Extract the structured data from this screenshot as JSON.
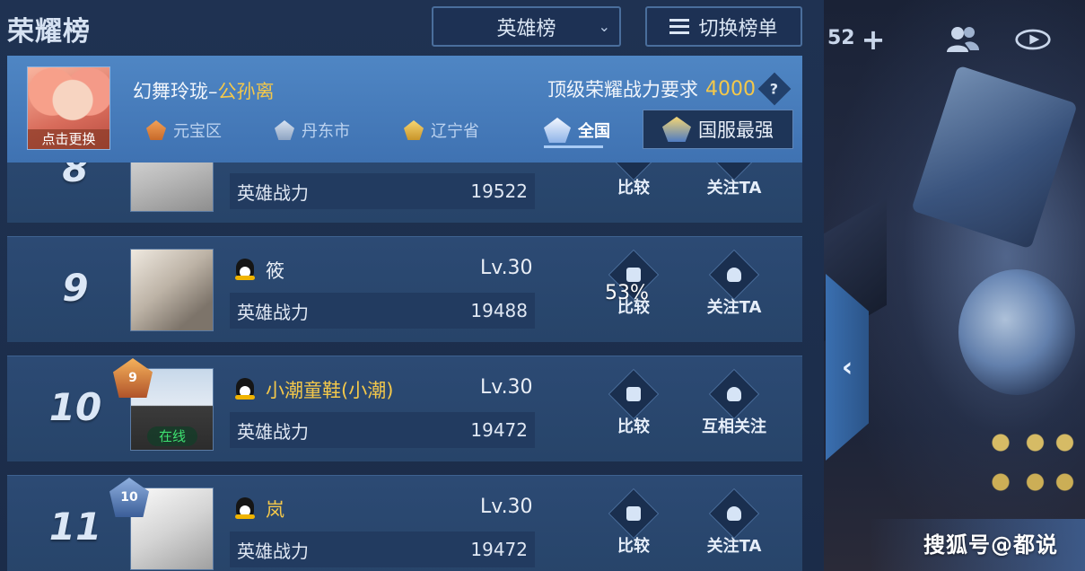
{
  "header": {
    "title": "荣耀榜",
    "rank_select": "英雄榜",
    "switch_button": "切换榜单"
  },
  "hero": {
    "hero_name": "幻舞玲珑",
    "separator": "–",
    "hero_skin": "公孙离",
    "portrait_caption": "点击更换",
    "requirement_label": "顶级荣耀战力要求",
    "requirement_value": "4000",
    "help_icon": "?",
    "regions": [
      {
        "label": "元宝区"
      },
      {
        "label": "丹东市"
      },
      {
        "label": "辽宁省"
      },
      {
        "label": "全国"
      }
    ],
    "strongest_button": "国服最强"
  },
  "side": {
    "top_count": "52",
    "watermark": "搜狐号@都说",
    "collapse_glyph": "‹"
  },
  "rows": [
    {
      "rank": "8",
      "name": "",
      "level": "",
      "power_label": "英雄战力",
      "power": "19522",
      "compare": "比较",
      "follow": "关注TA"
    },
    {
      "rank": "9",
      "name": "筱",
      "level": "Lv.30",
      "power_label": "英雄战力",
      "power": "19488",
      "compare": "比较",
      "follow": "关注TA",
      "percent": "53%"
    },
    {
      "rank": "10",
      "name": "小潮童鞋(小潮)",
      "level": "Lv.30",
      "power_label": "英雄战力",
      "power": "19472",
      "compare": "比较",
      "follow": "互相关注",
      "badge": "9",
      "online": "在线"
    },
    {
      "rank": "11",
      "name": "岚",
      "level": "Lv.30",
      "power_label": "英雄战力",
      "power": "19472",
      "compare": "比较",
      "follow": "关注TA",
      "badge": "10"
    }
  ],
  "colors": {
    "accent_gold": "#f4c84a",
    "hero_bar": "#4f86c4",
    "row_bg": "#2c4a74",
    "online_green": "#3ee070"
  }
}
